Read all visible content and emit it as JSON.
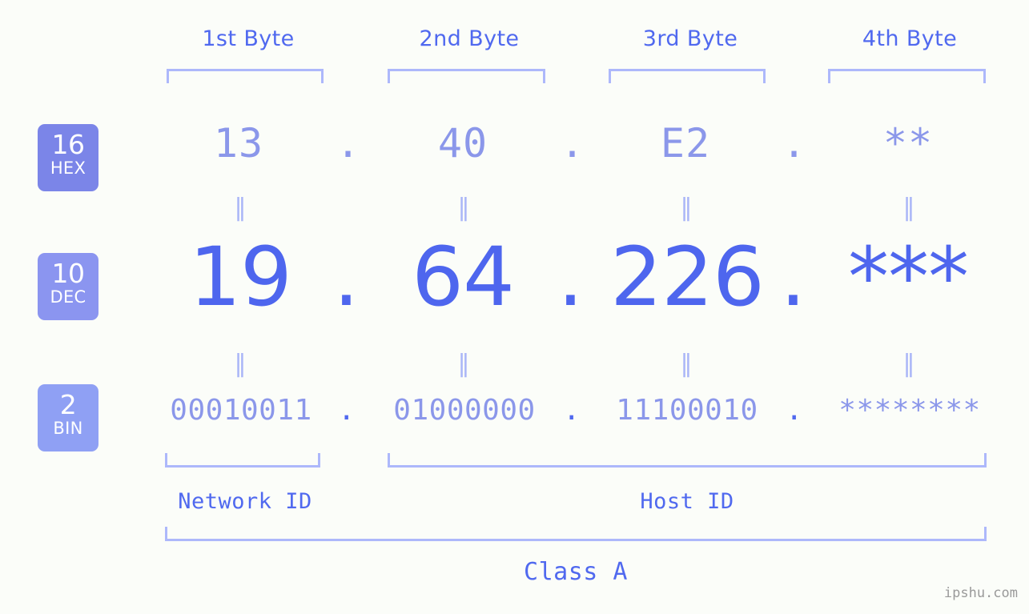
{
  "page": {
    "background_color": "#fbfdf9",
    "watermark": "ipshu.com"
  },
  "colors": {
    "accent_strong": "#4e66ee",
    "accent_medium": "#5069ef",
    "accent_light": "#8b97ea",
    "bracket": "#adb8fb",
    "badge_hex": "#7b85e8",
    "badge_dec": "#8b95f0",
    "badge_bin": "#8fa0f4"
  },
  "byte_headers": [
    {
      "label": "1st Byte"
    },
    {
      "label": "2nd Byte"
    },
    {
      "label": "3rd Byte"
    },
    {
      "label": "4th Byte"
    }
  ],
  "bases": [
    {
      "radix": "16",
      "abbr": "HEX"
    },
    {
      "radix": "10",
      "abbr": "DEC"
    },
    {
      "radix": "2",
      "abbr": "BIN"
    }
  ],
  "separator": {
    "dot": ".",
    "equals": "‖"
  },
  "rows": {
    "hex": {
      "values": [
        "13",
        "40",
        "E2",
        "**"
      ]
    },
    "dec": {
      "values": [
        "19",
        "64",
        "226",
        "***"
      ]
    },
    "bin": {
      "values": [
        "00010011",
        "01000000",
        "11100010",
        "********"
      ]
    }
  },
  "segments": {
    "network_id": "Network ID",
    "host_id": "Host ID",
    "class": "Class A"
  }
}
